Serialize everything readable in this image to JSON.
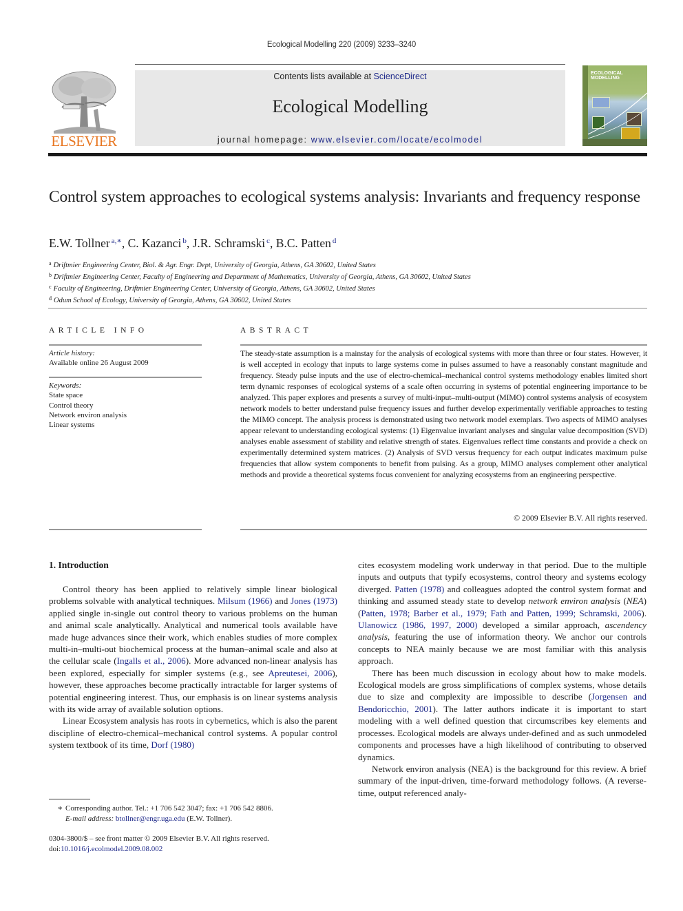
{
  "header": {
    "running_head": "Ecological Modelling 220 (2009) 3233–3240",
    "publisher_logo_text": "ELSEVIER",
    "contents_prefix": "Contents lists available at ",
    "contents_link": "ScienceDirect",
    "journal_name": "Ecological Modelling",
    "homepage_prefix": "journal homepage: ",
    "homepage_url": "www.elsevier.com/locate/ecolmodel",
    "cover_title_line1": "ECOLOGICAL",
    "cover_title_line2": "MODELLING",
    "colors": {
      "link": "#1f2a8a",
      "elsevier_orange": "#e87722",
      "masthead_bg": "#e8e8e8"
    }
  },
  "article": {
    "title": "Control system approaches to ecological systems analysis: Invariants and frequency response",
    "authors": [
      {
        "name": "E.W. Tollner",
        "affil": "a,∗",
        "sep": ", "
      },
      {
        "name": "C. Kazanci",
        "affil": "b",
        "sep": ", "
      },
      {
        "name": "J.R. Schramski",
        "affil": "c",
        "sep": ", "
      },
      {
        "name": "B.C. Patten",
        "affil": "d",
        "sep": ""
      }
    ],
    "affiliations": [
      {
        "key": "a",
        "text": "Driftmier Engineering Center, Biol. & Agr. Engr. Dept, University of Georgia, Athens, GA 30602, United States"
      },
      {
        "key": "b",
        "text": "Driftmier Engineering Center, Faculty of Engineering and Department of Mathematics, University of Georgia, Athens, GA 30602, United States"
      },
      {
        "key": "c",
        "text": "Faculty of Engineering, Driftmier Engineering Center, University of Georgia, Athens, GA 30602, United States"
      },
      {
        "key": "d",
        "text": "Odum School of Ecology, University of Georgia, Athens, GA 30602, United States"
      }
    ]
  },
  "article_info": {
    "heading": "ARTICLE INFO",
    "history_label": "Article history:",
    "history_value": "Available online 26 August 2009",
    "keywords_label": "Keywords:",
    "keywords": [
      "State space",
      "Control theory",
      "Network environ analysis",
      "Linear systems"
    ]
  },
  "abstract": {
    "heading": "ABSTRACT",
    "text": "The steady-state assumption is a mainstay for the analysis of ecological systems with more than three or four states. However, it is well accepted in ecology that inputs to large systems come in pulses assumed to have a reasonably constant magnitude and frequency. Steady pulse inputs and the use of electro-chemical–mechanical control systems methodology enables limited short term dynamic responses of ecological systems of a scale often occurring in systems of potential engineering importance to be analyzed. This paper explores and presents a survey of multi-input–multi-output (MIMO) control systems analysis of ecosystem network models to better understand pulse frequency issues and further develop experimentally verifiable approaches to testing the MIMO concept. The analysis process is demonstrated using two network model exemplars. Two aspects of MIMO analyses appear relevant to understanding ecological systems: (1) Eigenvalue invariant analyses and singular value decomposition (SVD) analyses enable assessment of stability and relative strength of states. Eigenvalues reflect time constants and provide a check on experimentally determined system matrices. (2) Analysis of SVD versus frequency for each output indicates maximum pulse frequencies that allow system components to benefit from pulsing. As a group, MIMO analyses complement other analytical methods and provide a theoretical systems focus convenient for analyzing ecosystems from an engineering perspective.",
    "copyright": "© 2009 Elsevier B.V. All rights reserved."
  },
  "body": {
    "section_heading": "1.  Introduction",
    "left_col": {
      "p1": [
        {
          "t": "Control theory has been applied to relatively simple linear biological problems solvable with analytical techniques. "
        },
        {
          "t": "Milsum (1966)",
          "link": true
        },
        {
          "t": " and "
        },
        {
          "t": "Jones (1973)",
          "link": true
        },
        {
          "t": " applied single in-single out control theory to various problems on the human and animal scale analytically. Analytical and numerical tools available have made huge advances since their work, which enables studies of more complex multi-in–multi-out biochemical process at the human–animal scale and also at the cellular scale ("
        },
        {
          "t": "Ingalls et al., 2006",
          "link": true
        },
        {
          "t": "). More advanced non-linear analysis has been explored, especially for simpler systems (e.g., see "
        },
        {
          "t": "Apreutesei, 2006",
          "link": true
        },
        {
          "t": "), however, these approaches become practically intractable for larger systems of potential engineering interest. Thus, our emphasis is on linear systems analysis with its wide array of available solution options."
        }
      ],
      "p2": [
        {
          "t": "Linear Ecosystem analysis has roots in cybernetics, which is also the parent discipline of electro-chemical–mechanical control systems. A popular control system textbook of its time, "
        },
        {
          "t": "Dorf (1980)",
          "link": true
        }
      ]
    },
    "right_col": {
      "p1": [
        {
          "t": "cites ecosystem modeling work underway in that period. Due to the multiple inputs and outputs that typify ecosystems, control theory and systems ecology diverged. "
        },
        {
          "t": "Patten (1978)",
          "link": true
        },
        {
          "t": " and colleagues adopted the control system format and thinking and assumed steady state to develop "
        },
        {
          "t": "network environ analysis",
          "em": true
        },
        {
          "t": " ("
        },
        {
          "t": "NEA",
          "em": true
        },
        {
          "t": ") ("
        },
        {
          "t": "Patten, 1978; Barber et al., 1979; Fath and Patten, 1999; Schramski, 2006",
          "link": true
        },
        {
          "t": "). "
        },
        {
          "t": "Ulanowicz (1986, 1997, 2000)",
          "link": true
        },
        {
          "t": " developed a similar approach, "
        },
        {
          "t": "ascendency analysis",
          "em": true
        },
        {
          "t": ", featuring the use of information theory. We anchor our controls concepts to NEA mainly because we are most familiar with this analysis approach."
        }
      ],
      "p2": [
        {
          "t": "There has been much discussion in ecology about how to make models. Ecological models are gross simplifications of complex systems, whose details due to size and complexity are impossible to describe ("
        },
        {
          "t": "Jorgensen and Bendoricchio, 2001",
          "link": true
        },
        {
          "t": "). The latter authors indicate it is important to start modeling with a well defined question that circumscribes key elements and processes. Ecological models are always under-defined and as such unmodeled components and processes have a high likelihood of contributing to observed dynamics."
        }
      ],
      "p3": [
        {
          "t": "Network environ analysis (NEA) is the background for this review. A brief summary of the input-driven, time-forward methodology follows. (A reverse-time, output referenced analy-"
        }
      ]
    }
  },
  "footnotes": {
    "star": "∗",
    "corresponding": "Corresponding author. Tel.: +1 706 542 3047; fax: +1 706 542 8806.",
    "email_label": "E-mail address:",
    "email": "btollner@engr.uga.edu",
    "email_suffix": " (E.W. Tollner).",
    "front_matter": "0304-3800/$ – see front matter © 2009 Elsevier B.V. All rights reserved.",
    "doi_prefix": "doi:",
    "doi": "10.1016/j.ecolmodel.2009.08.002"
  }
}
